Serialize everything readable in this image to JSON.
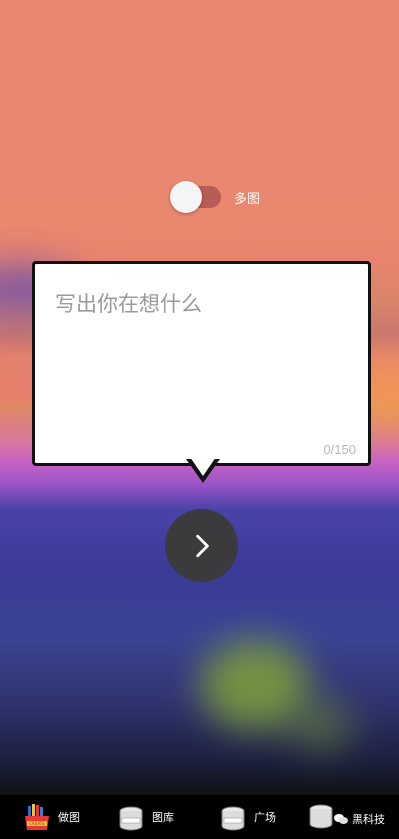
{
  "multi_toggle": {
    "label": "多图",
    "on": false
  },
  "composer": {
    "placeholder": "写出你在想什么",
    "counter": "0/150"
  },
  "next_button": {
    "icon": "chevron-right-icon"
  },
  "tabs": [
    {
      "label": "做图",
      "icon": "create-can-icon"
    },
    {
      "label": "图库",
      "icon": "paint-can-icon"
    },
    {
      "label": "广场",
      "icon": "paint-can-icon"
    }
  ],
  "watermark": "黑科技",
  "colors": {
    "accent": "#b85d56",
    "button": "#3b3a3d"
  }
}
